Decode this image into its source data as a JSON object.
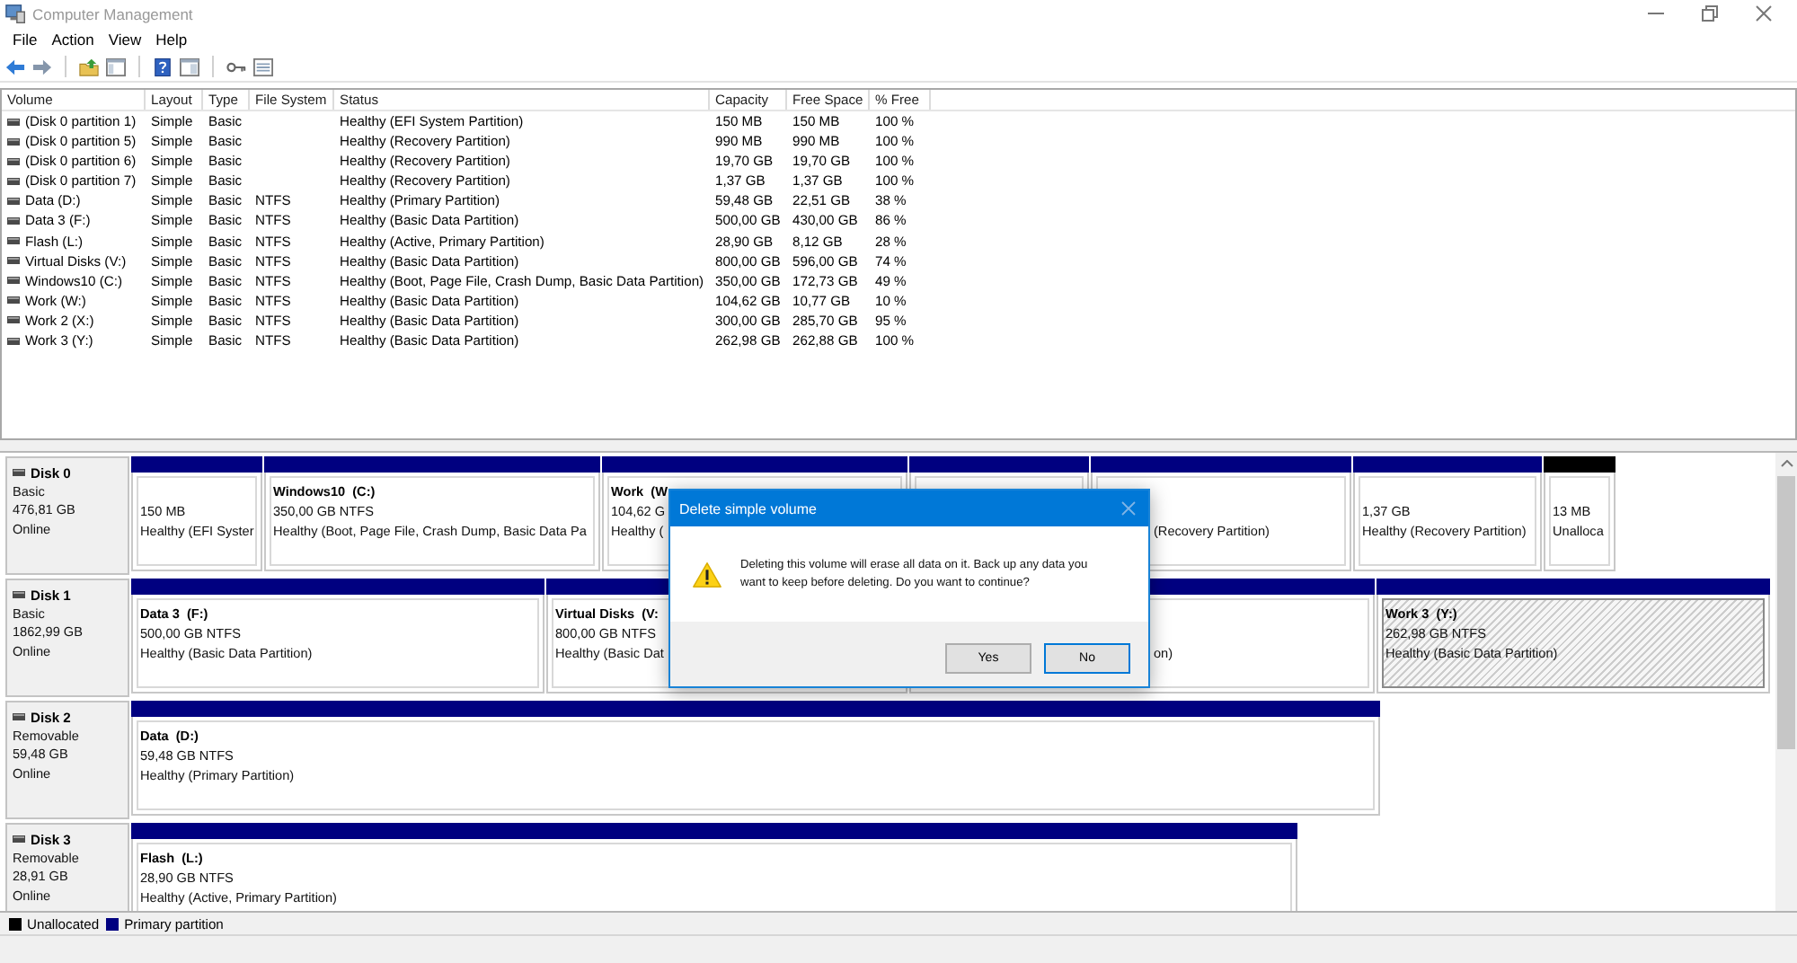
{
  "window": {
    "title": "Computer Management"
  },
  "menu": [
    "File",
    "Action",
    "View",
    "Help"
  ],
  "volumes": {
    "columns": [
      "Volume",
      "Layout",
      "Type",
      "File System",
      "Status",
      "Capacity",
      "Free Space",
      "% Free"
    ],
    "rows": [
      {
        "volume": "(Disk 0 partition 1)",
        "layout": "Simple",
        "type": "Basic",
        "status": "Healthy (EFI System Partition)",
        "capacity": "150 MB",
        "free_space": "150 MB",
        "percent_free": "100 %"
      },
      {
        "volume": "(Disk 0 partition 5)",
        "layout": "Simple",
        "type": "Basic",
        "status": "Healthy (Recovery Partition)",
        "capacity": "990 MB",
        "free_space": "990 MB",
        "percent_free": "100 %"
      },
      {
        "volume": "(Disk 0 partition 6)",
        "layout": "Simple",
        "type": "Basic",
        "status": "Healthy (Recovery Partition)",
        "capacity": "19,70 GB",
        "free_space": "19,70 GB",
        "percent_free": "100 %"
      },
      {
        "volume": "(Disk 0 partition 7)",
        "layout": "Simple",
        "type": "Basic",
        "status": "Healthy (Recovery Partition)",
        "capacity": "1,37 GB",
        "free_space": "1,37 GB",
        "percent_free": "100 %"
      },
      {
        "volume": "Data (D:)",
        "layout": "Simple",
        "type": "Basic",
        "file_system": "NTFS",
        "status": "Healthy (Primary Partition)",
        "capacity": "59,48 GB",
        "free_space": "22,51 GB",
        "percent_free": "38 %"
      },
      {
        "volume": "Data 3 (F:)",
        "layout": "Simple",
        "type": "Basic",
        "file_system": "NTFS",
        "status": "Healthy (Basic Data Partition)",
        "capacity": "500,00 GB",
        "free_space": "430,00 GB",
        "percent_free": "86 %"
      },
      {
        "volume": "Flash (L:)",
        "layout": "Simple",
        "type": "Basic",
        "file_system": "NTFS",
        "status": "Healthy (Active, Primary Partition)",
        "capacity": "28,90 GB",
        "free_space": "8,12 GB",
        "percent_free": "28 %"
      },
      {
        "volume": "Virtual Disks (V:)",
        "layout": "Simple",
        "type": "Basic",
        "file_system": "NTFS",
        "status": "Healthy (Basic Data Partition)",
        "capacity": "800,00 GB",
        "free_space": "596,00 GB",
        "percent_free": "74 %"
      },
      {
        "volume": "Windows10 (C:)",
        "layout": "Simple",
        "type": "Basic",
        "file_system": "NTFS",
        "status": "Healthy (Boot, Page File, Crash Dump, Basic Data Partition)",
        "capacity": "350,00 GB",
        "free_space": "172,73 GB",
        "percent_free": "49 %"
      },
      {
        "volume": "Work (W:)",
        "layout": "Simple",
        "type": "Basic",
        "file_system": "NTFS",
        "status": "Healthy (Basic Data Partition)",
        "capacity": "104,62 GB",
        "free_space": "10,77 GB",
        "percent_free": "10 %"
      },
      {
        "volume": "Work 2 (X:)",
        "layout": "Simple",
        "type": "Basic",
        "file_system": "NTFS",
        "status": "Healthy (Basic Data Partition)",
        "capacity": "300,00 GB",
        "free_space": "285,70 GB",
        "percent_free": "95 %"
      },
      {
        "volume": "Work 3 (Y:)",
        "layout": "Simple",
        "type": "Basic",
        "file_system": "NTFS",
        "status": "Healthy (Basic Data Partition)",
        "capacity": "262,98 GB",
        "free_space": "262,88 GB",
        "percent_free": "100 %"
      }
    ]
  },
  "disks": [
    {
      "name": "Disk 0",
      "type": "Basic",
      "size": "476,81 GB",
      "status": "Online",
      "partitions": [
        {
          "kind": "primary",
          "selected": false,
          "size": "150 MB",
          "status": "Healthy (EFI Syster"
        },
        {
          "kind": "primary",
          "selected": false,
          "name": "Windows10  (C:)",
          "size": "350,00 GB NTFS",
          "status": "Healthy (Boot, Page File, Crash Dump, Basic Data Pa"
        },
        {
          "kind": "primary",
          "selected": false,
          "name": "Work  (W",
          "size": "104,62 G",
          "status": "Healthy ("
        },
        {
          "kind": "primary",
          "selected": false
        },
        {
          "kind": "primary",
          "selected": false,
          "covered": true,
          "status": "(Recovery Partition)"
        },
        {
          "kind": "primary",
          "selected": false,
          "size": "1,37 GB",
          "status": "Healthy (Recovery Partition)"
        },
        {
          "kind": "unallocated",
          "selected": false,
          "size": "13 MB",
          "status": "Unalloca"
        }
      ]
    },
    {
      "name": "Disk 1",
      "type": "Basic",
      "size": "1862,99 GB",
      "status": "Online",
      "partitions": [
        {
          "kind": "primary",
          "selected": false,
          "name": "Data 3  (F:)",
          "size": "500,00 GB NTFS",
          "status": "Healthy (Basic Data Partition)"
        },
        {
          "kind": "primary",
          "selected": false,
          "name": "Virtual Disks  (V:",
          "size": "800,00 GB NTFS",
          "status": "Healthy (Basic Dat"
        },
        {
          "kind": "primary",
          "selected": false,
          "covered": true,
          "status": "on)"
        },
        {
          "kind": "primary",
          "selected": true,
          "name": "Work 3  (Y:)",
          "size": "262,98 GB NTFS",
          "status": "Healthy (Basic Data Partition)"
        }
      ]
    },
    {
      "name": "Disk 2",
      "type": "Removable",
      "size": "59,48 GB",
      "status": "Online",
      "partitions": [
        {
          "kind": "primary",
          "selected": false,
          "name": "Data  (D:)",
          "size": "59,48 GB NTFS",
          "status": "Healthy (Primary Partition)"
        }
      ]
    },
    {
      "name": "Disk 3",
      "type": "Removable",
      "size": "28,91 GB",
      "status": "Online",
      "partitions": [
        {
          "kind": "primary",
          "selected": false,
          "name": "Flash  (L:)",
          "size": "28,90 GB NTFS",
          "status": "Healthy (Active, Primary Partition)"
        }
      ]
    }
  ],
  "legend": [
    {
      "kind": "unallocated",
      "label": "Unallocated",
      "color": "#000000"
    },
    {
      "kind": "primary",
      "label": "Primary partition",
      "color": "#000080"
    }
  ],
  "dialog": {
    "title": "Delete simple volume",
    "message": "Deleting this volume will erase all data on it. Back up any data you want to keep before deleting. Do you want to continue?",
    "buttons": [
      {
        "label": "Yes",
        "focused": false
      },
      {
        "label": "No",
        "focused": true
      }
    ]
  }
}
